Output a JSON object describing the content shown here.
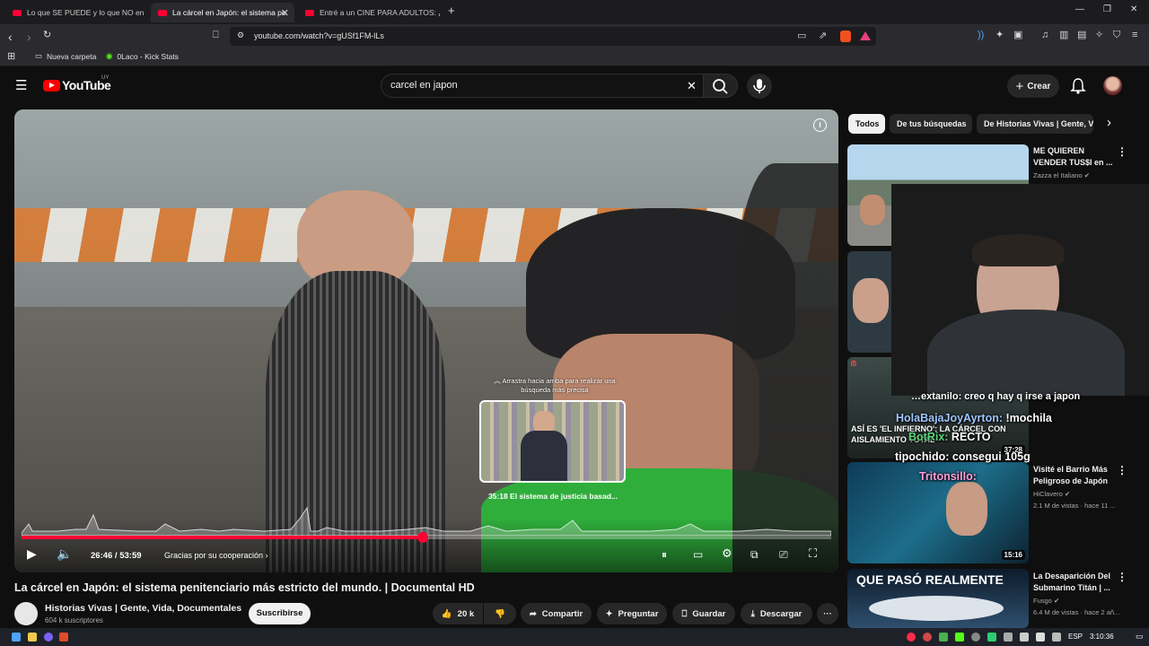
{
  "browser": {
    "tabs": [
      {
        "title": "Lo que SE PUEDE y lo que NO en"
      },
      {
        "title": "La cárcel en Japón: el sistema pe"
      },
      {
        "title": "Entré a un CINE PARA ADULTOS: ¿Cóm"
      }
    ],
    "url": "youtube.com/watch?v=gUSf1FM-lLs",
    "bookmarks": [
      "Nueva carpeta",
      "0Laco - Kick Stats"
    ]
  },
  "youtube": {
    "logo_text": "YouTube",
    "country_code": "UY",
    "search_value": "carcel en japon",
    "create_label": "Crear"
  },
  "player": {
    "preview_hint": "Arrastra hacia arriba para realizar una búsqueda más precisa",
    "preview_chapter": "35:18  El sistema de justicia basad...",
    "time_display": "26:46 / 53:59",
    "chapter_label": "Gracias por su cooperación",
    "progress_fraction": 0.496
  },
  "video": {
    "title": "La cárcel en Japón: el sistema penitenciario más estricto del mundo. | Documental HD",
    "channel": "Historias Vivas | Gente, Vida, Documentales",
    "subscribers": "604 k suscriptores",
    "subscribe_label": "Suscribirse",
    "likes": "20 k",
    "share_label": "Compartir",
    "ask_label": "Preguntar",
    "save_label": "Guardar",
    "download_label": "Descargar"
  },
  "sidebar": {
    "chips": [
      "Todos",
      "De tus búsquedas",
      "De Historias Vivas | Gente, Vi"
    ],
    "videos": [
      {
        "title": "ME QUIEREN VENDER TUS$I en ...",
        "channel": "Zazza el Italiano",
        "meta": "",
        "duration": ""
      },
      {
        "title": "",
        "channel": "",
        "meta": "",
        "duration": "37:28",
        "thumb_text": "ASÍ ES 'EL INFIERNO': LA CÁRCEL CON AISLAMIENTO TOTAL"
      },
      {
        "title": "Visité el Barrio Más Peligroso de Japón",
        "channel": "HiClavero",
        "meta": "2.1 M de vistas · hace 11 ...",
        "duration": "15:16"
      },
      {
        "title": "La Desaparición Del Submarino Titán | ...",
        "channel": "Fusgo",
        "meta": "6.4 M de vistas · hace 2 añ...",
        "duration": "",
        "thumb_text": "QUE PASÓ REALMENTE"
      }
    ]
  },
  "chat": [
    {
      "user": "",
      "text": "…extanilo: creo q hay q irse a japon"
    },
    {
      "user": "HolaBajaJoyAyrton:",
      "text": " !mochila"
    },
    {
      "user": "BotRix:",
      "text": " RECTO"
    },
    {
      "user": "tipochido:",
      "text": " consegui 105g"
    },
    {
      "user": "Tritonsillo:",
      "text": ""
    }
  ],
  "taskbar": {
    "lang": "ESP",
    "clock": "3:10:36"
  }
}
